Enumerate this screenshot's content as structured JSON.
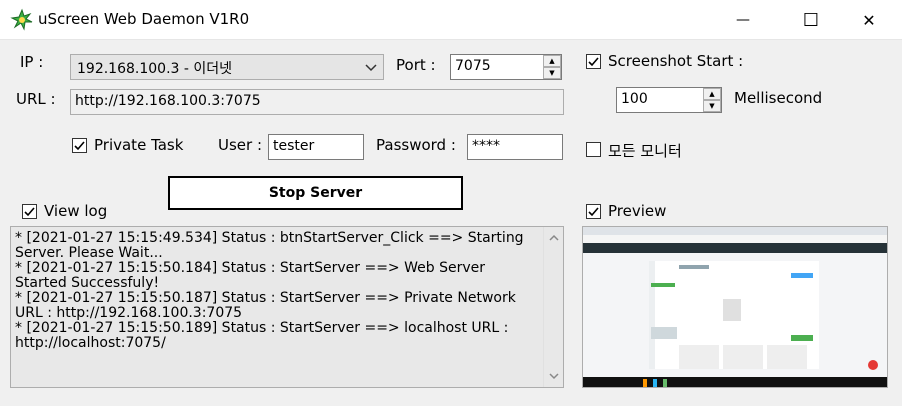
{
  "window": {
    "title": "uScreen Web Daemon V1R0",
    "minimize_glyph": "—",
    "maximize_glyph": "☐",
    "close_glyph": "✕"
  },
  "server": {
    "ip_label": "IP :",
    "ip_selected": "192.168.100.3 - 이더넷",
    "port_label": "Port :",
    "port_value": "7075",
    "url_label": "URL :",
    "url_value": "http://192.168.100.3:7075"
  },
  "auth": {
    "private_task_label": "Private Task",
    "private_task_checked": true,
    "user_label": "User :",
    "user_value": "tester",
    "password_label": "Password :",
    "password_value": "****"
  },
  "screenshot": {
    "start_label": "Screenshot Start :",
    "start_checked": true,
    "interval_value": "100",
    "interval_unit": "Mellisecond",
    "all_monitors_label": "모든 모니터",
    "all_monitors_checked": false,
    "preview_label": "Preview",
    "preview_checked": true
  },
  "actions": {
    "stop_server_label": "Stop Server"
  },
  "log": {
    "view_log_label": "View log",
    "view_log_checked": true,
    "lines": [
      "* [2021-01-27 15:15:49.534] Status : btnStartServer_Click ==> Starting Server. Please Wait...",
      "* [2021-01-27 15:15:50.184] Status : StartServer ==> Web Server Started Successfuly!",
      "* [2021-01-27 15:15:50.187] Status : StartServer ==> Private Network URL : http://192.168.100.3:7075",
      "* [2021-01-27 15:15:50.189] Status : StartServer ==> localhost URL : http://localhost:7075/"
    ]
  },
  "icons": {
    "app": "uscreen-app-icon",
    "check": "checkmark-icon",
    "dropdown": "chevron-down-icon",
    "spin_up": "spin-up-icon",
    "spin_down": "spin-down-icon"
  }
}
